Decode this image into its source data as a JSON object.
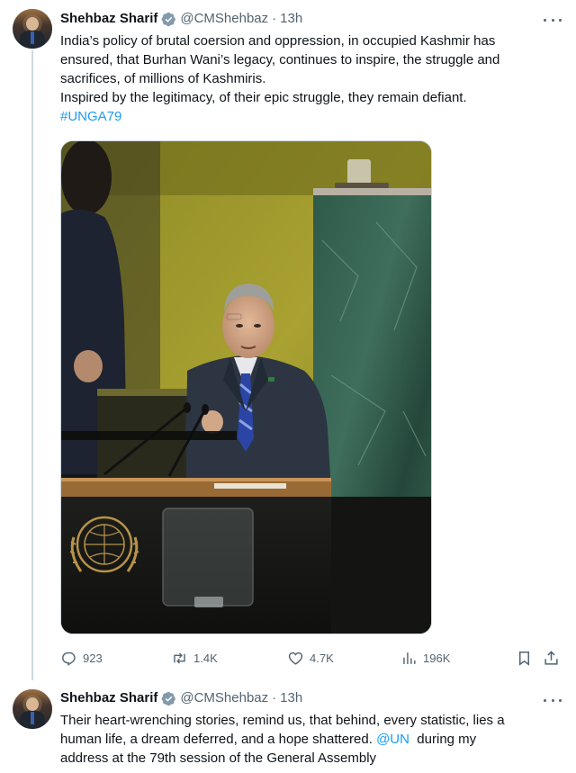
{
  "tweets": [
    {
      "author": {
        "name": "Shehbaz Sharif",
        "handle": "@CMShehbaz",
        "separator": "·",
        "time": "13h"
      },
      "lines": [
        "India’s policy of brutal coersion and oppression, in occupied Kashmir has",
        "ensured, that Burhan Wani’s legacy, continues to inspire, the struggle and",
        "sacrifices, of millions of Kashmiris.",
        "Inspired by the legitimacy, of their epic struggle, they remain defiant."
      ],
      "hashtag": "#UNGA79",
      "stats": {
        "replies": "923",
        "reposts": "1.4K",
        "likes": "4.7K",
        "views": "196K"
      }
    },
    {
      "author": {
        "name": "Shehbaz Sharif",
        "handle": "@CMShehbaz",
        "separator": "·",
        "time": "13h"
      },
      "line1": "Their heart-wrenching stories, remind us, that behind, every statistic, lies a",
      "line2_before": "human life, a dream deferred, and a hope shattered. ",
      "mention": "@UN",
      "line2_after": "  during my",
      "line3": "address at the 79th session of the General Assembly"
    }
  ],
  "colors": {
    "link": "#1d9bf0",
    "muted": "#536471",
    "text": "#0f1419",
    "verified": "#829aab"
  },
  "icons": [
    "more-icon",
    "verified-badge-icon",
    "reply-icon",
    "repost-icon",
    "like-icon",
    "views-icon",
    "bookmark-icon",
    "share-icon",
    "un-emblem"
  ]
}
